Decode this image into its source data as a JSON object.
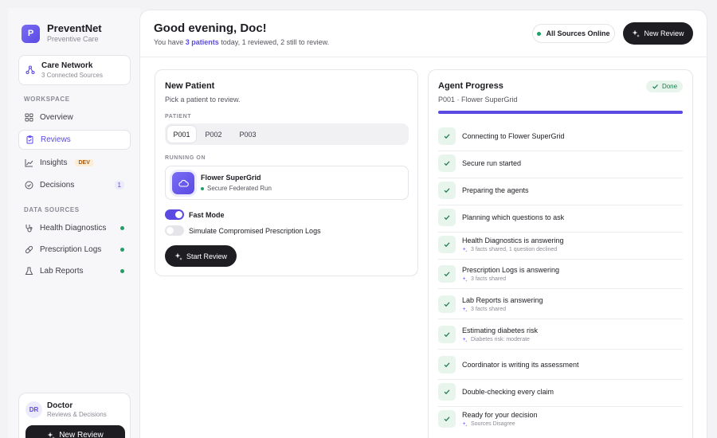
{
  "brand": {
    "initial": "P",
    "name": "PreventNet",
    "subtitle": "Preventive Care"
  },
  "network": {
    "title": "Care Network",
    "subtitle": "3 Connected Sources"
  },
  "sidebar": {
    "workspace_label": "WORKSPACE",
    "items": [
      {
        "label": "Overview"
      },
      {
        "label": "Reviews"
      },
      {
        "label": "Insights",
        "badge": "DEV"
      },
      {
        "label": "Decisions",
        "count": "1"
      }
    ],
    "data_sources_label": "DATA SOURCES",
    "sources": [
      {
        "label": "Health Diagnostics"
      },
      {
        "label": "Prescription Logs"
      },
      {
        "label": "Lab Reports"
      }
    ],
    "status_color": "#1fa067"
  },
  "doctor": {
    "initials": "DR",
    "name": "Doctor",
    "role": "Reviews & Decisions",
    "button": "New Review"
  },
  "header": {
    "greeting": "Good evening, Doc!",
    "summary_prefix": "You have ",
    "summary_highlight": "3 patients",
    "summary_suffix": " today, 1 reviewed, 2 still to review.",
    "sources_status": "All Sources Online",
    "new_review": "New Review"
  },
  "patient_card": {
    "title": "New Patient",
    "subtitle": "Pick a patient to review.",
    "patient_label": "PATIENT",
    "patients": [
      "P001",
      "P002",
      "P003"
    ],
    "running_label": "RUNNING ON",
    "run_title": "Flower SuperGrid",
    "run_sub": "Secure Federated Run",
    "fast_mode": "Fast Mode",
    "simulate": "Simulate Compromised Prescription Logs",
    "start": "Start Review"
  },
  "agent_card": {
    "title": "Agent Progress",
    "status": "Done",
    "subtitle": "P001 · Flower SuperGrid",
    "progress": 1.0,
    "steps": [
      {
        "title": "Connecting to Flower SuperGrid"
      },
      {
        "title": "Secure run started"
      },
      {
        "title": "Preparing the agents"
      },
      {
        "title": "Planning which questions to ask"
      },
      {
        "title": "Health Diagnostics is answering",
        "detail": "3 facts shared, 1 question declined"
      },
      {
        "title": "Prescription Logs is answering",
        "detail": "3 facts shared"
      },
      {
        "title": "Lab Reports is answering",
        "detail": "3 facts shared"
      },
      {
        "title": "Estimating diabetes risk",
        "detail": "Diabetes risk: moderate"
      },
      {
        "title": "Coordinator is writing its assessment"
      },
      {
        "title": "Double-checking every claim"
      },
      {
        "title": "Ready for your decision",
        "detail": "Sources Disagree"
      }
    ]
  },
  "colors": {
    "accent": "#5a4ae3",
    "success": "#1fa067",
    "dark": "#1d1d22"
  }
}
